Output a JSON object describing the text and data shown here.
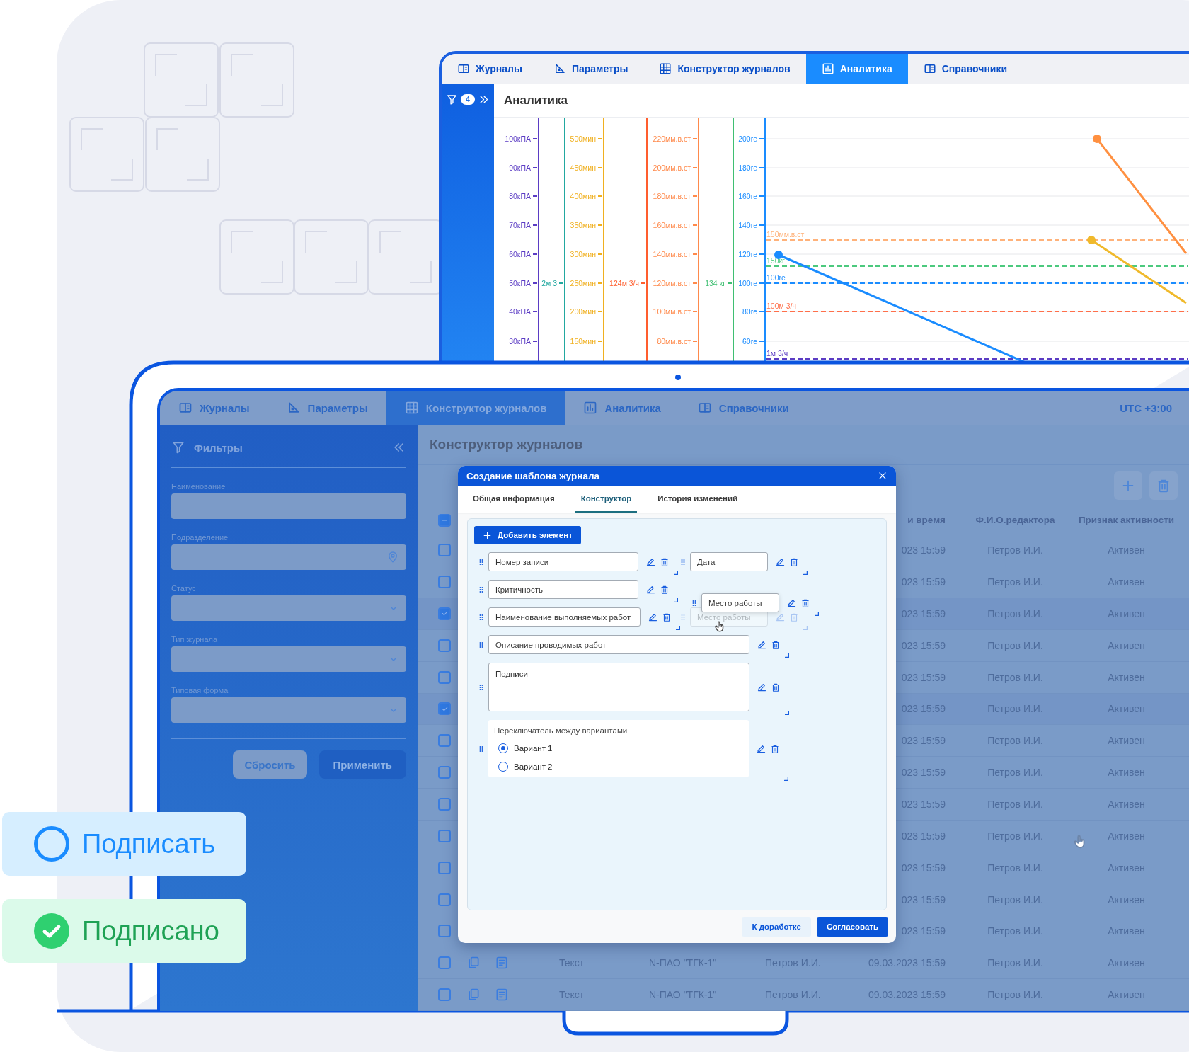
{
  "analytics_window": {
    "tabs": [
      {
        "label": "Журналы",
        "selected": false
      },
      {
        "label": "Параметры",
        "selected": false
      },
      {
        "label": "Конструктор журналов",
        "selected": false
      },
      {
        "label": "Аналитика",
        "selected": true
      },
      {
        "label": "Справочники",
        "selected": false
      }
    ],
    "filter_badge": "4",
    "title": "Аналитика",
    "chart": {
      "axes": [
        {
          "color": "#5b3cc4",
          "ticks": [
            "100кПА",
            "90кПА",
            "80кПА",
            "70кПА",
            "60кПА",
            "50кПА",
            "40кПА",
            "30кПА"
          ]
        },
        {
          "color": "#22a8a0",
          "ticks": [
            "2м 3"
          ]
        },
        {
          "color": "#f0b020",
          "ticks": [
            "500мин",
            "450мин",
            "400мин",
            "350мин",
            "300мин",
            "250мин",
            "200мин",
            "150мин"
          ]
        },
        {
          "color": "#ff5e2e",
          "ticks": [
            "124м 3/ч"
          ]
        },
        {
          "color": "#ff8a4c",
          "ticks": [
            "220мм.в.ст",
            "200мм.в.ст",
            "180мм.в.ст",
            "160мм.в.ст",
            "140мм.в.ст",
            "120мм.в.ст",
            "100мм.в.ст",
            "80мм.в.ст"
          ]
        },
        {
          "color": "#3fbf72",
          "ticks": [
            "134 кг"
          ]
        },
        {
          "color": "#1a8cff",
          "ticks": [
            "200re",
            "180re",
            "160re",
            "140re",
            "120re",
            "100re",
            "80re",
            "60re"
          ]
        }
      ],
      "thresholds": [
        {
          "label": "150мм.в.ст",
          "color": "#ffb27a"
        },
        {
          "label": "150кг",
          "color": "#4cc97e"
        },
        {
          "label": "100re",
          "color": "#1a8cff"
        },
        {
          "label": "100м 3/ч",
          "color": "#ff6f4a"
        },
        {
          "label": "1м 3/ч",
          "color": "#5b3cc4"
        }
      ],
      "trend_lines": [
        {
          "color": "#ff9040"
        },
        {
          "color": "#f0b92b"
        },
        {
          "color": "#1a8cff"
        }
      ]
    }
  },
  "journal_window": {
    "tabs": [
      {
        "label": "Журналы",
        "selected": false
      },
      {
        "label": "Параметры",
        "selected": false
      },
      {
        "label": "Конструктор журналов",
        "selected": true
      },
      {
        "label": "Аналитика",
        "selected": false
      },
      {
        "label": "Справочники",
        "selected": false
      }
    ],
    "timezone": "UTC +3:00",
    "filters": {
      "title": "Фильтры",
      "fields": [
        {
          "label": "Наименование",
          "kind": "text"
        },
        {
          "label": "Подразделение",
          "kind": "location"
        },
        {
          "label": "Статус",
          "kind": "select"
        },
        {
          "label": "Тип журнала",
          "kind": "select"
        },
        {
          "label": "Типовая форма",
          "kind": "select"
        }
      ],
      "buttons": [
        {
          "label": "Сбросить",
          "kind": "secondary"
        },
        {
          "label": "Применить",
          "kind": "primary"
        }
      ]
    },
    "title": "Конструктор журналов",
    "table": {
      "select_all_partial": true,
      "columns": [
        "и время",
        "Ф.И.О.редактора",
        "Признак активности"
      ],
      "rows": [
        {
          "kind": "partial",
          "checked": false,
          "cells": [
            "023 15:59",
            "Петров И.И.",
            "Активен"
          ]
        },
        {
          "kind": "partial",
          "checked": false,
          "cells": [
            "023 15:59",
            "Петров И.И.",
            "Активен"
          ]
        },
        {
          "kind": "partial",
          "checked": true,
          "cells": [
            "023 15:59",
            "Петров И.И.",
            "Активен"
          ]
        },
        {
          "kind": "partial",
          "checked": false,
          "cells": [
            "023 15:59",
            "Петров И.И.",
            "Активен"
          ]
        },
        {
          "kind": "partial",
          "checked": false,
          "cells": [
            "023 15:59",
            "Петров И.И.",
            "Активен"
          ]
        },
        {
          "kind": "partial",
          "checked": true,
          "cells": [
            "023 15:59",
            "Петров И.И.",
            "Активен"
          ]
        },
        {
          "kind": "partial",
          "checked": false,
          "cells": [
            "023 15:59",
            "Петров И.И.",
            "Активен"
          ]
        },
        {
          "kind": "partial",
          "checked": false,
          "cells": [
            "023 15:59",
            "Петров И.И.",
            "Активен"
          ]
        },
        {
          "kind": "partial",
          "checked": false,
          "cells": [
            "023 15:59",
            "Петров И.И.",
            "Активен"
          ]
        },
        {
          "kind": "partial",
          "checked": false,
          "cells": [
            "023 15:59",
            "Петров И.И.",
            "Активен"
          ]
        },
        {
          "kind": "partial",
          "checked": false,
          "cells": [
            "023 15:59",
            "Петров И.И.",
            "Активен"
          ]
        },
        {
          "kind": "partial",
          "checked": false,
          "cells": [
            "023 15:59",
            "Петров И.И.",
            "Активен"
          ]
        },
        {
          "kind": "partial",
          "checked": false,
          "cells": [
            "023 15:59",
            "Петров И.И.",
            "Активен"
          ]
        },
        {
          "kind": "full",
          "checked": false,
          "cells": [
            "Текст",
            "N-ПАО \"ТГК-1\"",
            "Петров И.И.",
            "09.03.2023 15:59",
            "Петров И.И.",
            "Активен"
          ]
        },
        {
          "kind": "full",
          "checked": false,
          "cells": [
            "Текст",
            "N-ПАО \"ТГК-1\"",
            "Петров И.И.",
            "09.03.2023 15:59",
            "Петров И.И.",
            "Активен"
          ]
        }
      ]
    }
  },
  "dialog": {
    "title": "Создание шаблона журнала",
    "tabs": [
      {
        "label": "Общая информация",
        "selected": false
      },
      {
        "label": "Конструктор",
        "selected": true
      },
      {
        "label": "История изменений",
        "selected": false
      }
    ],
    "add_button": "Добавить элемент",
    "rows": [
      [
        {
          "kind": "input",
          "label": "Номер записи",
          "ghost": false
        },
        {
          "kind": "input",
          "label": "Дата",
          "ghost": false
        }
      ],
      [
        {
          "kind": "input",
          "label": "Критичность",
          "ghost": false
        }
      ],
      [
        {
          "kind": "input",
          "label": "Наименование выполняемых работ",
          "ghost": false
        },
        {
          "kind": "input",
          "label": "Место работы",
          "ghost": true
        }
      ],
      [
        {
          "kind": "input",
          "label": "Описание проводимых работ",
          "ghost": false
        }
      ],
      [
        {
          "kind": "textarea",
          "label": "Подписи",
          "ghost": false
        }
      ],
      [
        {
          "kind": "radio_group",
          "label": "Переключатель между вариантами",
          "ghost": false,
          "options": [
            {
              "label": "Вариант 1",
              "selected": true
            },
            {
              "label": "Вариант 2",
              "selected": false
            }
          ]
        }
      ]
    ],
    "dragged": {
      "label": "Место работы"
    },
    "buttons": [
      {
        "label": "К доработке",
        "kind": "secondary"
      },
      {
        "label": "Согласовать",
        "kind": "primary"
      }
    ]
  },
  "status_badges": [
    {
      "label": "Подписать",
      "kind": "pending"
    },
    {
      "label": "Подписано",
      "kind": "signed"
    }
  ]
}
